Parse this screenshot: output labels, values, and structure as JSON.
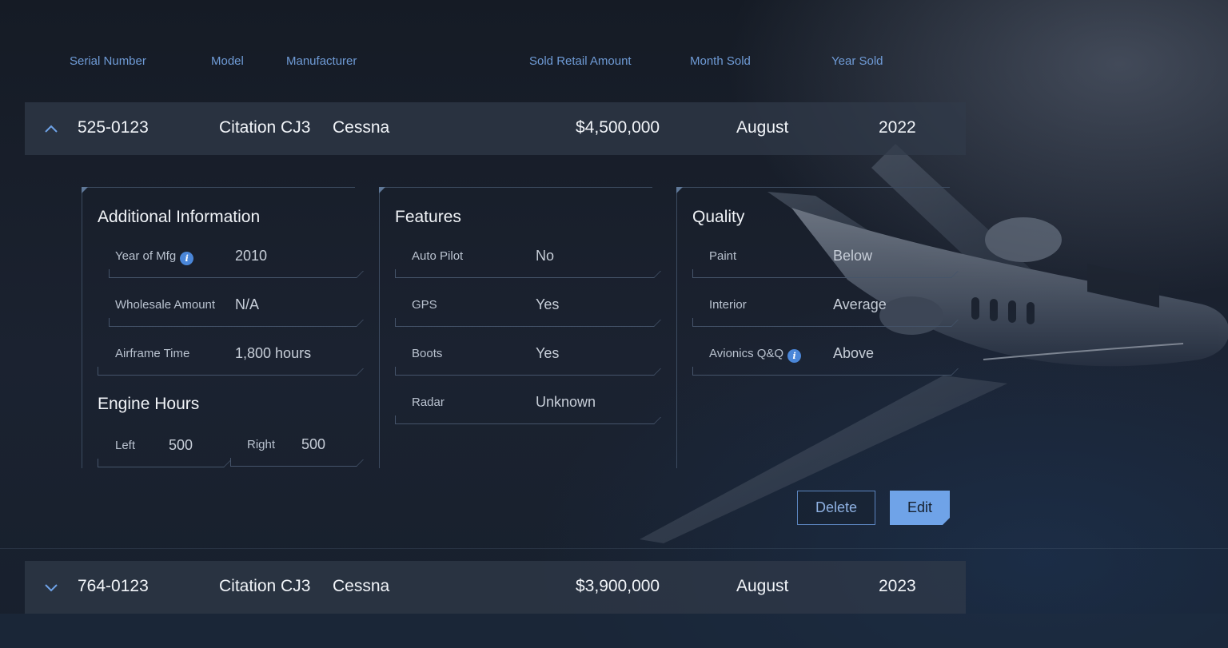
{
  "columns": {
    "serial": "Serial Number",
    "model": "Model",
    "manufacturer": "Manufacturer",
    "sold_retail": "Sold Retail Amount",
    "month_sold": "Month Sold",
    "year_sold": "Year Sold"
  },
  "rows": [
    {
      "serial": "525-0123",
      "model": "Citation CJ3",
      "manufacturer": "Cessna",
      "amount": "$4,500,000",
      "month": "August",
      "year": "2022",
      "expanded": true,
      "chevron": "chevron-up-icon"
    },
    {
      "serial": "764-0123",
      "model": "Citation CJ3",
      "manufacturer": "Cessna",
      "amount": "$3,900,000",
      "month": "August",
      "year": "2023",
      "expanded": false,
      "chevron": "chevron-down-icon"
    }
  ],
  "details": {
    "additional": {
      "title": "Additional Information",
      "fields": [
        {
          "label": "Year of Mfg",
          "value": "2010",
          "info": true
        },
        {
          "label": "Wholesale Amount",
          "value": "N/A"
        },
        {
          "label": "Airframe Time",
          "value": "1,800 hours"
        }
      ],
      "engine_title": "Engine Hours",
      "engine": [
        {
          "label": "Left",
          "value": "500"
        },
        {
          "label": "Right",
          "value": "500"
        }
      ]
    },
    "features": {
      "title": "Features",
      "fields": [
        {
          "label": "Auto Pilot",
          "value": "No"
        },
        {
          "label": "GPS",
          "value": "Yes"
        },
        {
          "label": "Boots",
          "value": "Yes"
        },
        {
          "label": "Radar",
          "value": "Unknown"
        }
      ]
    },
    "quality": {
      "title": "Quality",
      "fields": [
        {
          "label": "Paint",
          "value": "Below"
        },
        {
          "label": "Interior",
          "value": "Average"
        },
        {
          "label": "Avionics Q&Q",
          "value": "Above",
          "info": true
        }
      ]
    }
  },
  "actions": {
    "delete": "Delete",
    "edit": "Edit"
  },
  "colors": {
    "accent": "#6fa3e8",
    "header_text": "#6f9bd6",
    "row_bg": "#303a4a",
    "info_icon": "#4a86d8"
  }
}
